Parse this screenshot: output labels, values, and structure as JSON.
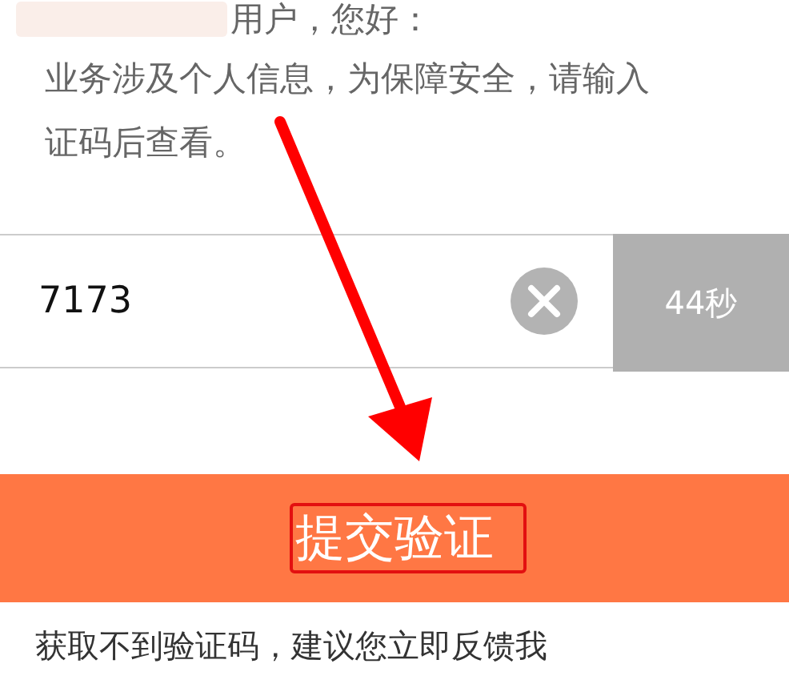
{
  "greeting": "用户，您好：",
  "notice_lines": [
    "业务涉及个人信息，为保障安全，请输入",
    "证码后查看。"
  ],
  "code_input": {
    "value": "7173"
  },
  "countdown_button": {
    "label": "44秒",
    "disabled": true
  },
  "submit_button": {
    "label": "提交验证"
  },
  "footer_text": "获取不到验证码，建议您立即反馈我"
}
